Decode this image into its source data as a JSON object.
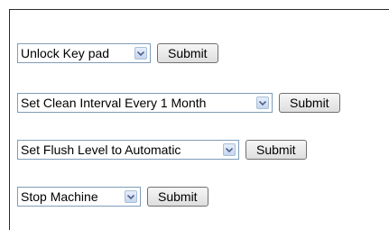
{
  "rows": [
    {
      "selected": "Unlock Key pad",
      "button": "Submit"
    },
    {
      "selected": "Set Clean Interval Every 1 Month",
      "button": "Submit"
    },
    {
      "selected": "Set Flush Level to Automatic",
      "button": "Submit"
    },
    {
      "selected": "Stop Machine",
      "button": "Submit"
    }
  ],
  "icons": {
    "dropdown": "chevron-down-icon"
  },
  "colors": {
    "select_border": "#7f9db9",
    "dropdown_bg": "#c6d5f0",
    "button_border": "#707070"
  }
}
